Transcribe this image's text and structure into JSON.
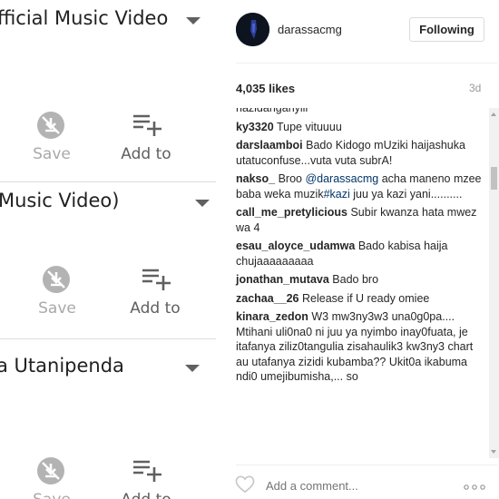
{
  "youtube": {
    "sections": [
      {
        "title": "fficial Music Video",
        "save_label": "Save",
        "add_label": "Add to"
      },
      {
        "title": "Music Video)",
        "save_label": "Save",
        "add_label": "Add to"
      },
      {
        "title": "a Utanipenda",
        "save_label": "Save",
        "add_label": "Add to"
      }
    ]
  },
  "instagram": {
    "username": "darassacmg",
    "follow_label": "Following",
    "likes": "4,035 likes",
    "age": "3d",
    "comments": [
      {
        "user": "",
        "text": "nazidanganyiii"
      },
      {
        "user": "ky3320",
        "text": "Tupe vituuuu"
      },
      {
        "user": "darslaamboi",
        "text": "Bado Kidogo mUziki haijashuka utatuconfuse...vuta vuta subrA!"
      },
      {
        "user": "nakso_",
        "pre": "Broo ",
        "mention": "@darassacmg",
        "mid": " acha maneno mzee baba weka muzik",
        "hashtag": "#kazi",
        "post": " juu ya kazi yani.........."
      },
      {
        "user": "call_me_pretylicious",
        "text": "Subir kwanza hata mwez wa 4"
      },
      {
        "user": "esau_aloyce_udamwa",
        "text": "Bado kabisa haija chujaaaaaaaaa"
      },
      {
        "user": "jonathan_mutava",
        "text": "Bado bro"
      },
      {
        "user": "zachaa__26",
        "text": "Release if U ready omiee"
      },
      {
        "user": "kinara_zedon",
        "text": "W3 mw3ny3w3 una0g0pa.... Mtihani uli0na0 ni juu ya nyimbo inay0fuata, je itafanya ziliz0tangulia zisahaulik3 kw3ny3 chart au utafanya zizidi kubamba?? Ukit0a ikabuma ndi0 umejibumisha,... so"
      }
    ],
    "add_comment_placeholder": "Add a comment...",
    "icons": {
      "heart": "heart-icon",
      "more": "more-options-icon",
      "save": "save-offline-icon",
      "add": "playlist-add-icon",
      "caret": "caret-down-icon"
    }
  }
}
